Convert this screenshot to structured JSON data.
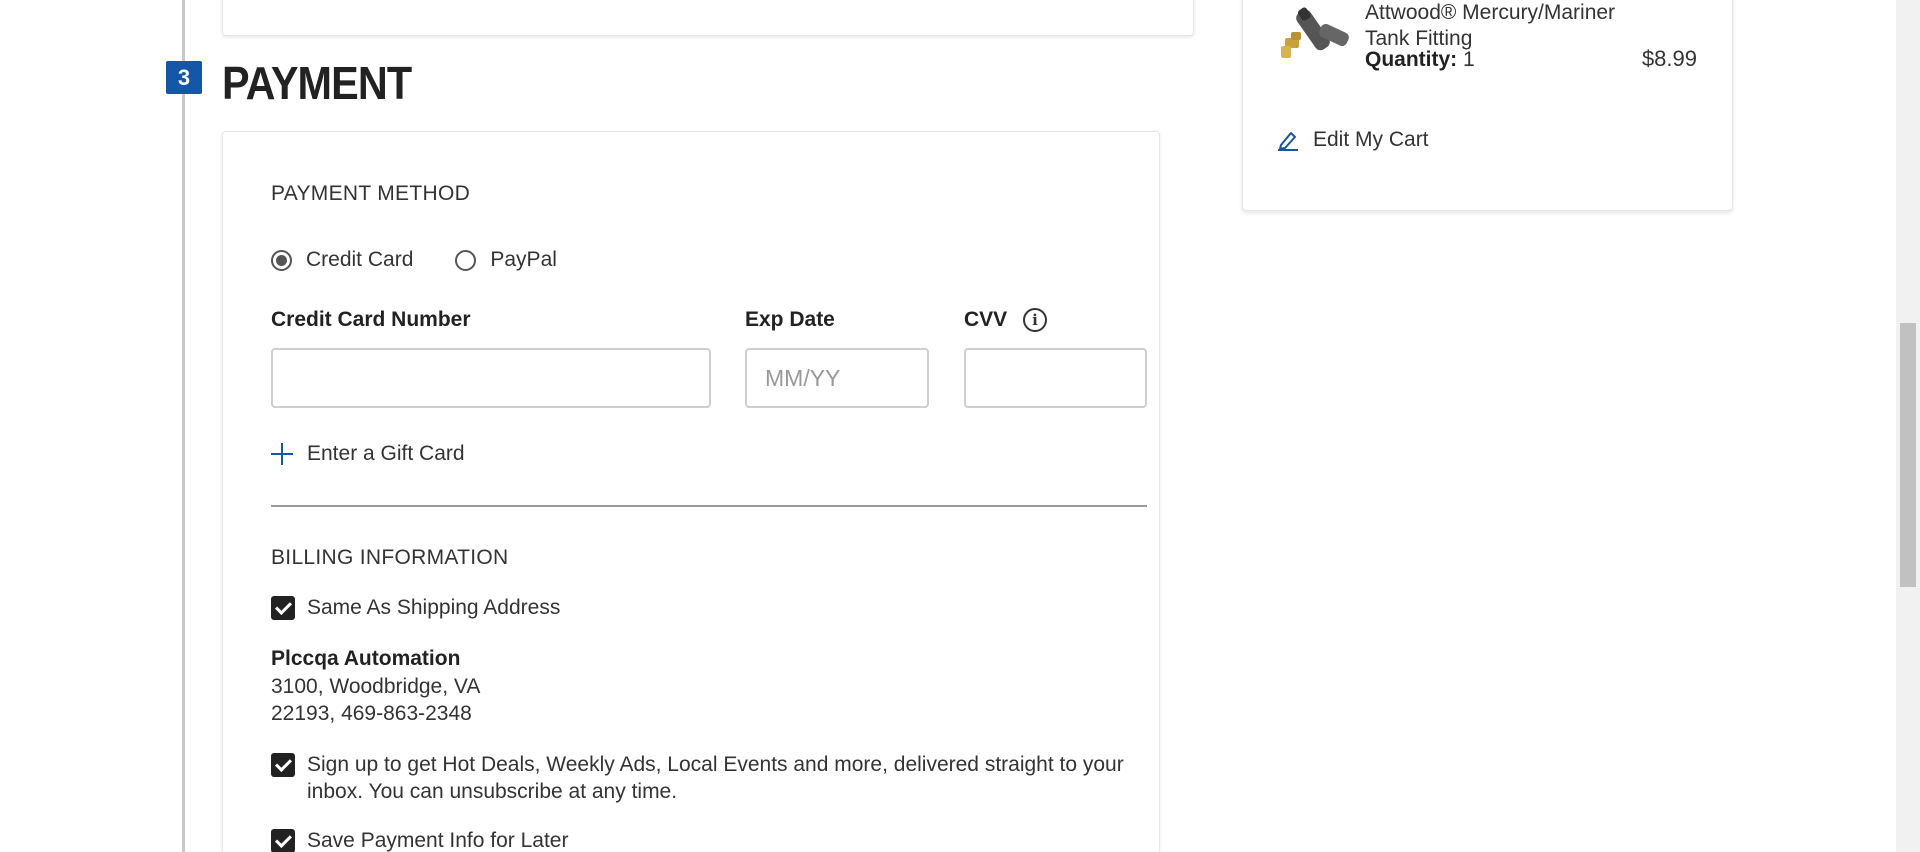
{
  "step": {
    "number": "3",
    "title": "PAYMENT"
  },
  "payment": {
    "method_heading": "PAYMENT METHOD",
    "options": [
      {
        "label": "Credit Card",
        "selected": true
      },
      {
        "label": "PayPal",
        "selected": false
      }
    ],
    "card_number": {
      "label": "Credit Card Number",
      "value": "",
      "placeholder": ""
    },
    "exp_date": {
      "label": "Exp Date",
      "value": "",
      "placeholder": "MM/YY"
    },
    "cvv": {
      "label": "CVV",
      "value": "",
      "placeholder": "",
      "info_icon": "info-icon"
    },
    "gift_card_label": "Enter a Gift Card"
  },
  "billing": {
    "heading": "BILLING INFORMATION",
    "same_as_shipping": {
      "label": "Same As Shipping Address",
      "checked": true
    },
    "name": "Plccqa Automation",
    "address_line1": "3100, Woodbridge, VA",
    "address_line2": "22193, 469-863-2348",
    "newsletter": {
      "label": "Sign up to get Hot Deals, Weekly Ads, Local Events and more, delivered straight to your inbox. You can unsubscribe at any time.",
      "checked": true
    },
    "save_payment": {
      "label": "Save Payment Info for Later",
      "checked": true
    }
  },
  "summary": {
    "product_name_line1": "Attwood® Mercury/Mariner",
    "product_name_line2": "Tank Fitting",
    "quantity_label": "Quantity:",
    "quantity_value": "1",
    "price": "$8.99",
    "edit_cart_label": "Edit My Cart"
  },
  "colors": {
    "accent": "#1456a8",
    "checkbox": "#222222"
  }
}
